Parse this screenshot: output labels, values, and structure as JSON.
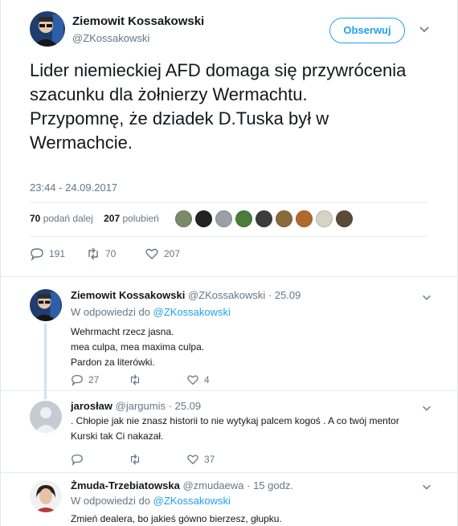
{
  "main_tweet": {
    "author_name": "Ziemowit Kossakowski",
    "author_handle": "@ZKossakowski",
    "follow_label": "Obserwuj",
    "text": "Lider niemieckiej AFD domaga się przywrócenia szacunku dla żołnierzy Wermachtu.\nPrzypomnę, że dziadek D.Tuska był w Wermachcie.",
    "timestamp": "23:44 - 24.09.2017",
    "retweets_count": "70",
    "retweets_label": "podań dalej",
    "likes_count": "207",
    "likes_label": "polubień",
    "reply_count": "191",
    "retweet_action_count": "70",
    "like_action_count": "207",
    "liker_colors": [
      "#7a8a6a",
      "#222222",
      "#9aa0a6",
      "#4a7d3b",
      "#3c3c3c",
      "#8a6a3c",
      "#b06a2e",
      "#d8d2c4",
      "#5a4a3a"
    ]
  },
  "replies": [
    {
      "author_name": "Ziemowit Kossakowski",
      "author_handle": "@ZKossakowski",
      "time": "· 25.09",
      "in_reply_prefix": "W odpowiedzi do",
      "in_reply_handle": "@ZKossakowski",
      "text": "Wehrmacht rzecz jasna.\nmea culpa, mea maxima culpa.\nPardon za literówki.",
      "reply_count": "27",
      "retweet_count": "",
      "like_count": "4"
    },
    {
      "author_name": "jarosław",
      "author_handle": "@jargumis",
      "time": "· 25.09",
      "text": ". Chłopie jak nie znasz historii to nie wytykaj palcem kogoś . A co twój mentor Kurski tak Ci nakazał.",
      "reply_count": "",
      "retweet_count": "",
      "like_count": "37"
    },
    {
      "author_name": "Żmuda-Trzebiatowska",
      "author_handle": "@zmudaewa",
      "time": "· 15 godz.",
      "in_reply_prefix": "W odpowiedzi do",
      "in_reply_handle": "@ZKossakowski",
      "text": "Zmień dealera, bo jakieś gówno bierzesz, głupku."
    }
  ],
  "colors": {
    "accent": "#1da1f2",
    "muted": "#657786",
    "text": "#14171a",
    "border": "#e6ecf0"
  }
}
